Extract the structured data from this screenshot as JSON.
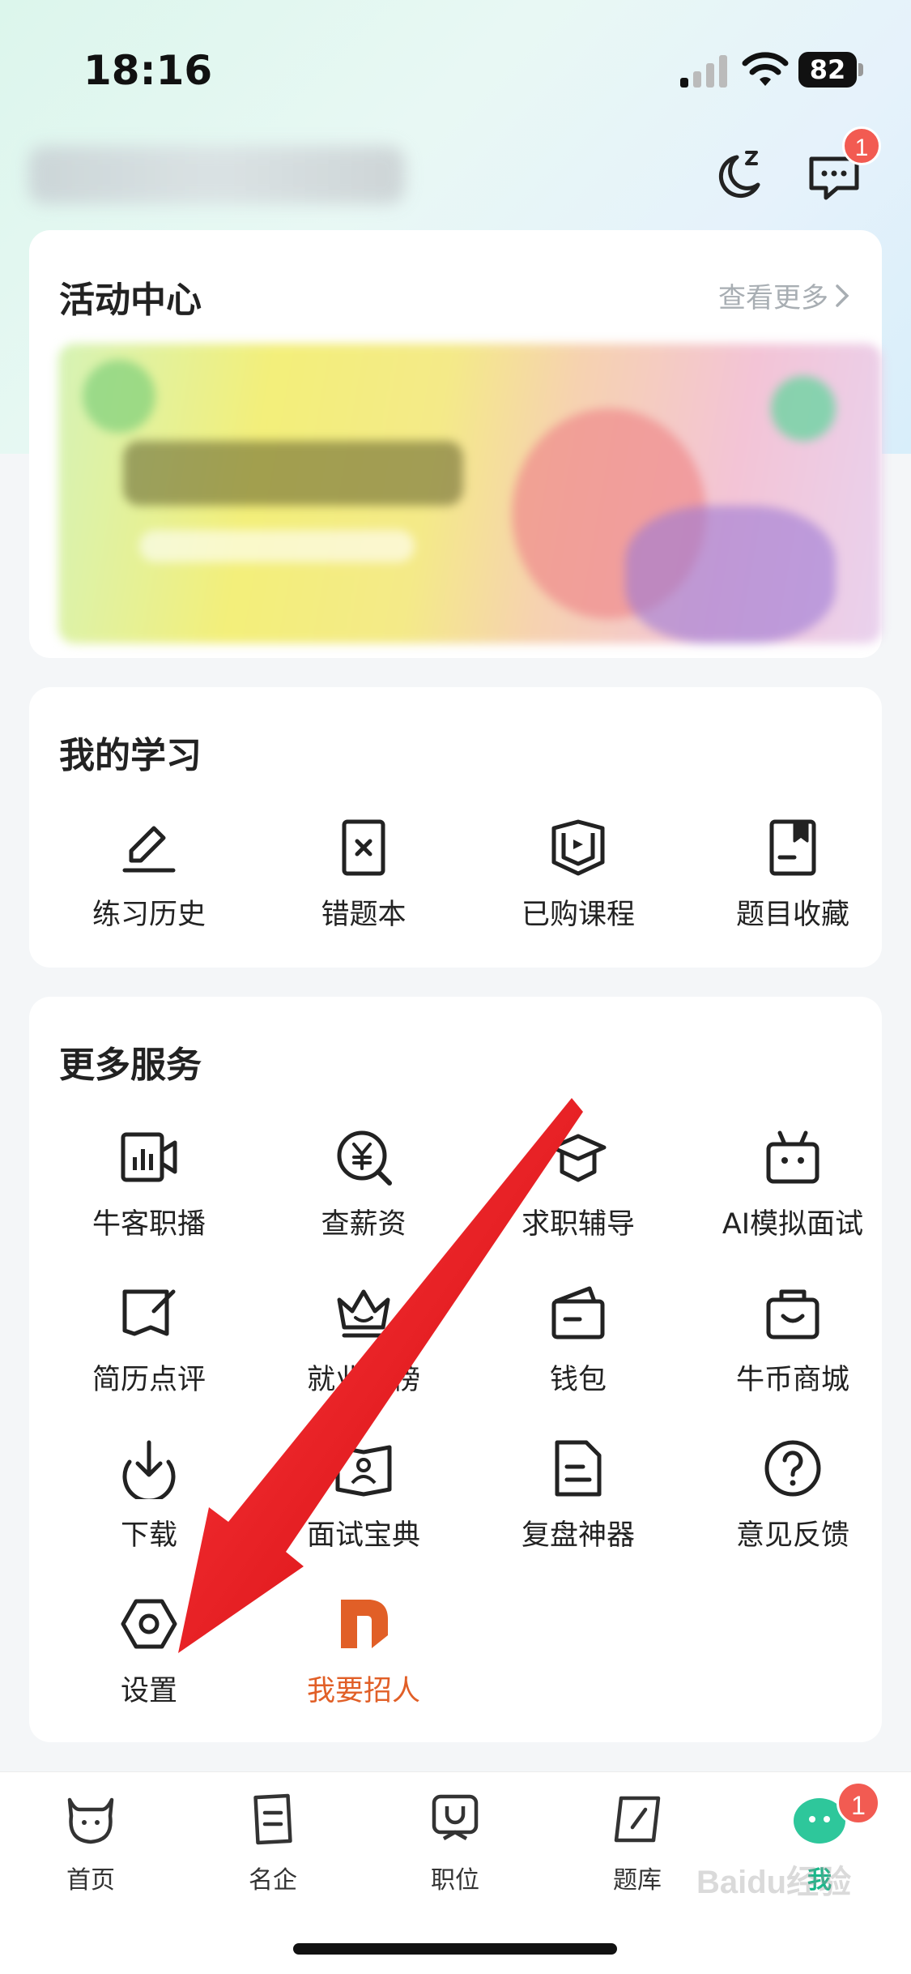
{
  "status_bar": {
    "time": "18:16",
    "battery": "82"
  },
  "header": {
    "message_badge": "1"
  },
  "activity": {
    "title": "活动中心",
    "see_more": "查看更多"
  },
  "study": {
    "title": "我的学习",
    "items": [
      {
        "label": "练习历史",
        "icon": "pencil-icon"
      },
      {
        "label": "错题本",
        "icon": "wrong-book-icon"
      },
      {
        "label": "已购课程",
        "icon": "course-icon"
      },
      {
        "label": "题目收藏",
        "icon": "bookmark-icon"
      }
    ]
  },
  "services": {
    "title": "更多服务",
    "items": [
      {
        "label": "牛客职播",
        "icon": "live-video-icon"
      },
      {
        "label": "查薪资",
        "icon": "yen-search-icon"
      },
      {
        "label": "求职辅导",
        "icon": "graduation-cap-icon"
      },
      {
        "label": "AI模拟面试",
        "icon": "robot-icon"
      },
      {
        "label": "简历点评",
        "icon": "resume-edit-icon"
      },
      {
        "label": "就业热榜",
        "icon": "crown-icon"
      },
      {
        "label": "钱包",
        "icon": "wallet-icon"
      },
      {
        "label": "牛币商城",
        "icon": "shop-bag-icon"
      },
      {
        "label": "下载",
        "icon": "download-icon"
      },
      {
        "label": "面试宝典",
        "icon": "interview-book-icon"
      },
      {
        "label": "复盘神器",
        "icon": "document-icon"
      },
      {
        "label": "意见反馈",
        "icon": "question-icon"
      },
      {
        "label": "设置",
        "icon": "settings-hex-icon"
      },
      {
        "label": "我要招人",
        "icon": "recruit-logo-icon"
      }
    ]
  },
  "tabbar": {
    "tabs": [
      {
        "label": "首页",
        "icon": "cow-home-icon"
      },
      {
        "label": "名企",
        "icon": "company-icon"
      },
      {
        "label": "职位",
        "icon": "position-icon"
      },
      {
        "label": "题库",
        "icon": "question-bank-icon"
      },
      {
        "label": "我",
        "icon": "me-avatar-icon"
      }
    ],
    "me_badge": "1"
  },
  "watermark": "Baidu经验",
  "colors": {
    "accent": "#19b88a",
    "badge": "#f25b52",
    "recruit": "#e15f27",
    "arrow": "#e8161b"
  }
}
